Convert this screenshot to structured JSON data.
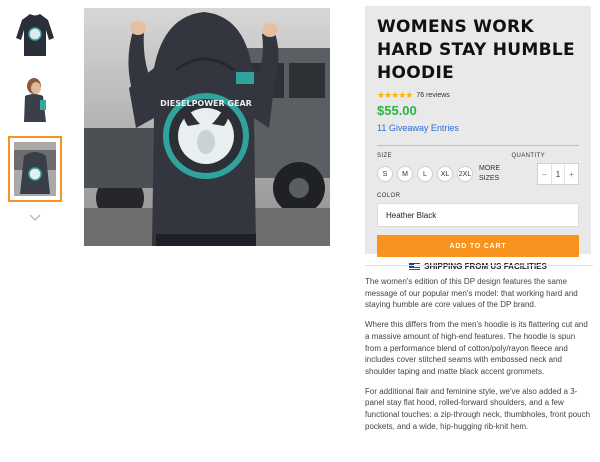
{
  "product": {
    "title": "WOMENS WORK HARD STAY HUMBLE HOODIE",
    "stars": "★★★★★",
    "reviews": "76 reviews",
    "price": "$55.00",
    "giveaway": "11 Giveaway Entries"
  },
  "options": {
    "size_label": "SIZE",
    "quantity_label": "QUANTITY",
    "sizes": [
      "S",
      "M",
      "L",
      "XL",
      "2XL"
    ],
    "more_sizes": "MORE SIZES",
    "quantity": "1",
    "minus": "−",
    "plus": "+",
    "color_label": "COLOR",
    "color_value": "Heather Black"
  },
  "actions": {
    "add_to_cart": "ADD TO CART",
    "shipping": "SHIPPING FROM US FACILITIES"
  },
  "image": {
    "logo_text": "DIESELPOWER GEAR"
  },
  "description": [
    "The women's edition of this DP design features the same message of our popular men's model: that working hard and staying humble are core values of the DP brand.",
    "Where this differs from the men's hoodie is its flattering cut and a massive amount of high-end features. The hoodie is spun from a performance blend of cotton/poly/rayon fleece and includes cover stitched seams with embossed neck and shoulder taping and matte black accent grommets.",
    "For additional flair and feminine style, we've also added a 3-panel stay flat hood, rolled-forward shoulders, and a few functional touches: a zip-through neck, thumbholes, front pouch pockets, and a wide, hip-hugging rib-knit hem."
  ],
  "colors": {
    "accent": "#f7931e",
    "price": "#2cb34a",
    "link": "#2a6fd6",
    "panel": "#e9e9e9"
  }
}
